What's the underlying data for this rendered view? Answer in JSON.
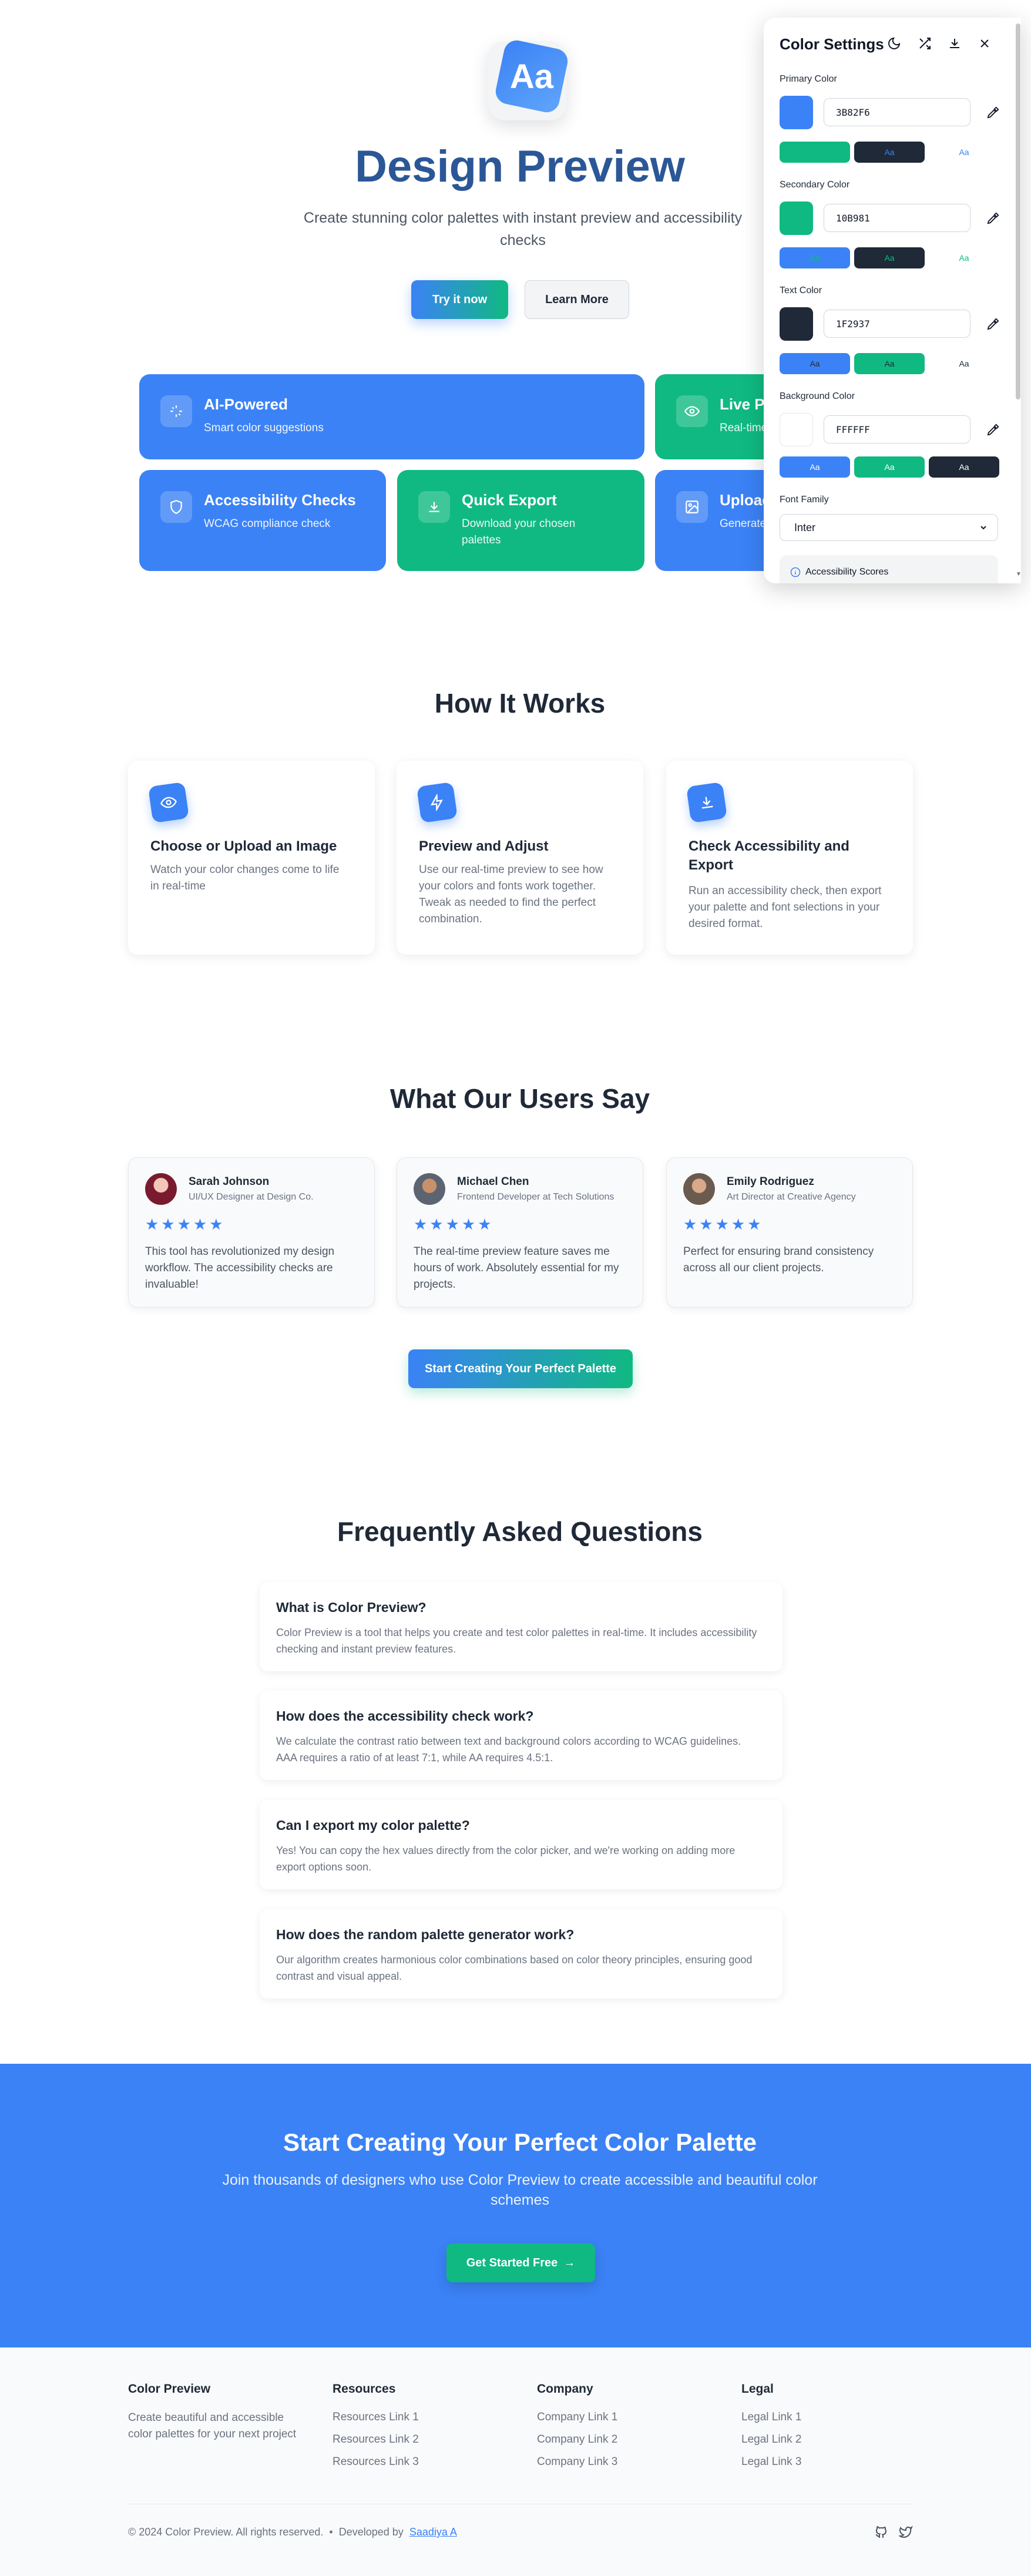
{
  "hero": {
    "logo_text": "Aa",
    "title": "Design Preview",
    "subtitle": "Create stunning color palettes with instant preview and accessibility checks",
    "try_label": "Try it now",
    "learn_label": "Learn More"
  },
  "features": [
    {
      "title": "AI-Powered",
      "desc": "Smart color suggestions",
      "icon": "sparkles-icon",
      "color": "blue"
    },
    {
      "title": "Live Preview",
      "desc": "Real-time updates",
      "icon": "eye-icon",
      "color": "green"
    },
    {
      "title": "Accessibility Checks",
      "desc": "WCAG compliance check",
      "icon": "shield-icon",
      "color": "blue"
    },
    {
      "title": "Quick Export",
      "desc": "Download your chosen palettes",
      "icon": "download-icon",
      "color": "green"
    },
    {
      "title": "Upload Image",
      "desc": "Generate palettes",
      "icon": "image-icon",
      "color": "blue"
    }
  ],
  "how": {
    "title": "How It Works",
    "steps": [
      {
        "title": "Choose or Upload an Image",
        "desc": "Watch your color changes come to life in real-time",
        "icon": "eye-icon"
      },
      {
        "title": "Preview and Adjust",
        "desc": "Use our real-time preview to see how your colors and fonts work together. Tweak as needed to find the perfect combination.",
        "icon": "bolt-icon"
      },
      {
        "title": "Check Accessibility and Export",
        "desc": "Run an accessibility check, then export your palette and font selections in your desired format.",
        "icon": "download-icon"
      }
    ]
  },
  "testimonials": {
    "title": "What Our Users Say",
    "stars": "★★★★★",
    "items": [
      {
        "name": "Sarah Johnson",
        "role": "UI/UX Designer at Design Co.",
        "quote": "This tool has revolutionized my design workflow. The accessibility checks are invaluable!"
      },
      {
        "name": "Michael Chen",
        "role": "Frontend Developer at Tech Solutions",
        "quote": "The real-time preview feature saves me hours of work. Absolutely essential for my projects."
      },
      {
        "name": "Emily Rodriguez",
        "role": "Art Director at Creative Agency",
        "quote": "Perfect for ensuring brand consistency across all our client projects."
      }
    ],
    "cta_label": "Start Creating Your Perfect Palette"
  },
  "faq": {
    "title": "Frequently Asked Questions",
    "items": [
      {
        "q": "What is Color Preview?",
        "a": "Color Preview is a tool that helps you create and test color palettes in real-time. It includes accessibility checking and instant preview features."
      },
      {
        "q": "How does the accessibility check work?",
        "a": "We calculate the contrast ratio between text and background colors according to WCAG guidelines. AAA requires a ratio of at least 7:1, while AA requires 4.5:1."
      },
      {
        "q": "Can I export my color palette?",
        "a": "Yes! You can copy the hex values directly from the color picker, and we're working on adding more export options soon."
      },
      {
        "q": "How does the random palette generator work?",
        "a": "Our algorithm creates harmonious color combinations based on color theory principles, ensuring good contrast and visual appeal."
      }
    ]
  },
  "cta": {
    "title": "Start Creating Your Perfect Color Palette",
    "subtitle": "Join thousands of designers who use Color Preview to create accessible and beautiful color schemes",
    "button": "Get Started Free",
    "arrow": "→"
  },
  "footer": {
    "brand": "Color Preview",
    "brand_desc": "Create beautiful and accessible color palettes for your next project",
    "columns": [
      {
        "title": "Resources",
        "links": [
          "Resources Link 1",
          "Resources Link 2",
          "Resources Link 3"
        ]
      },
      {
        "title": "Company",
        "links": [
          "Company Link 1",
          "Company Link 2",
          "Company Link 3"
        ]
      },
      {
        "title": "Legal",
        "links": [
          "Legal Link 1",
          "Legal Link 2",
          "Legal Link 3"
        ]
      }
    ],
    "copyright": "© 2024 Color Preview. All rights reserved.",
    "bullet": "•",
    "dev_prefix": "Developed by",
    "dev_name": "Saadiya A"
  },
  "panel": {
    "title": "Color Settings",
    "preview_text": "Aa",
    "colors": [
      {
        "label": "Primary Color",
        "hex": "3B82F6",
        "swatch": "#3B82F6"
      },
      {
        "label": "Secondary Color",
        "hex": "10B981",
        "swatch": "#10B981"
      },
      {
        "label": "Text Color",
        "hex": "1F2937",
        "swatch": "#1F2937"
      },
      {
        "label": "Background Color",
        "hex": "FFFFFF",
        "swatch": "#FFFFFF"
      }
    ],
    "font_label": "Font Family",
    "font_value": "Inter",
    "scores_label": "Accessibility Scores"
  }
}
